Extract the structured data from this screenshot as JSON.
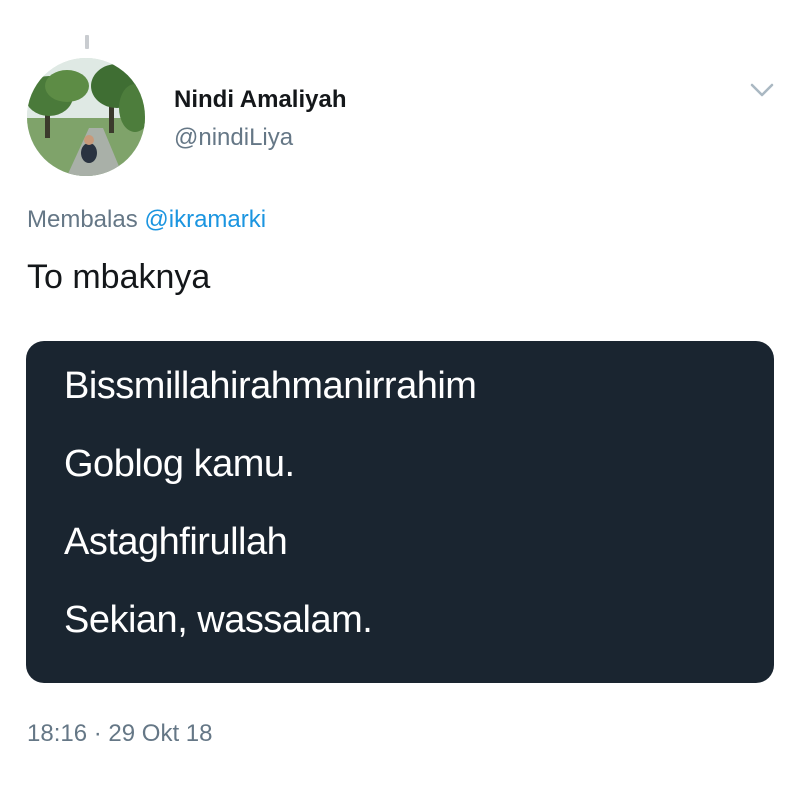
{
  "tweet": {
    "author": {
      "display_name": "Nindi Amaliyah",
      "handle": "@nindiLiya",
      "avatar_icon": "profile-photo"
    },
    "menu_icon": "chevron-down-icon",
    "reply_prefix": "Membalas",
    "reply_to": "@ikramarki",
    "text": "To mbaknya",
    "image_card": {
      "lines": [
        "Bissmillahirahmanirrahim",
        "Goblog kamu.",
        "Astaghfirullah",
        "Sekian, wassalam."
      ],
      "background_color": "#1a2530"
    },
    "time": "18:16",
    "separator": "·",
    "date": "29 Okt 18"
  },
  "colors": {
    "text_primary": "#14171a",
    "text_secondary": "#657786",
    "link": "#1b95e0"
  }
}
